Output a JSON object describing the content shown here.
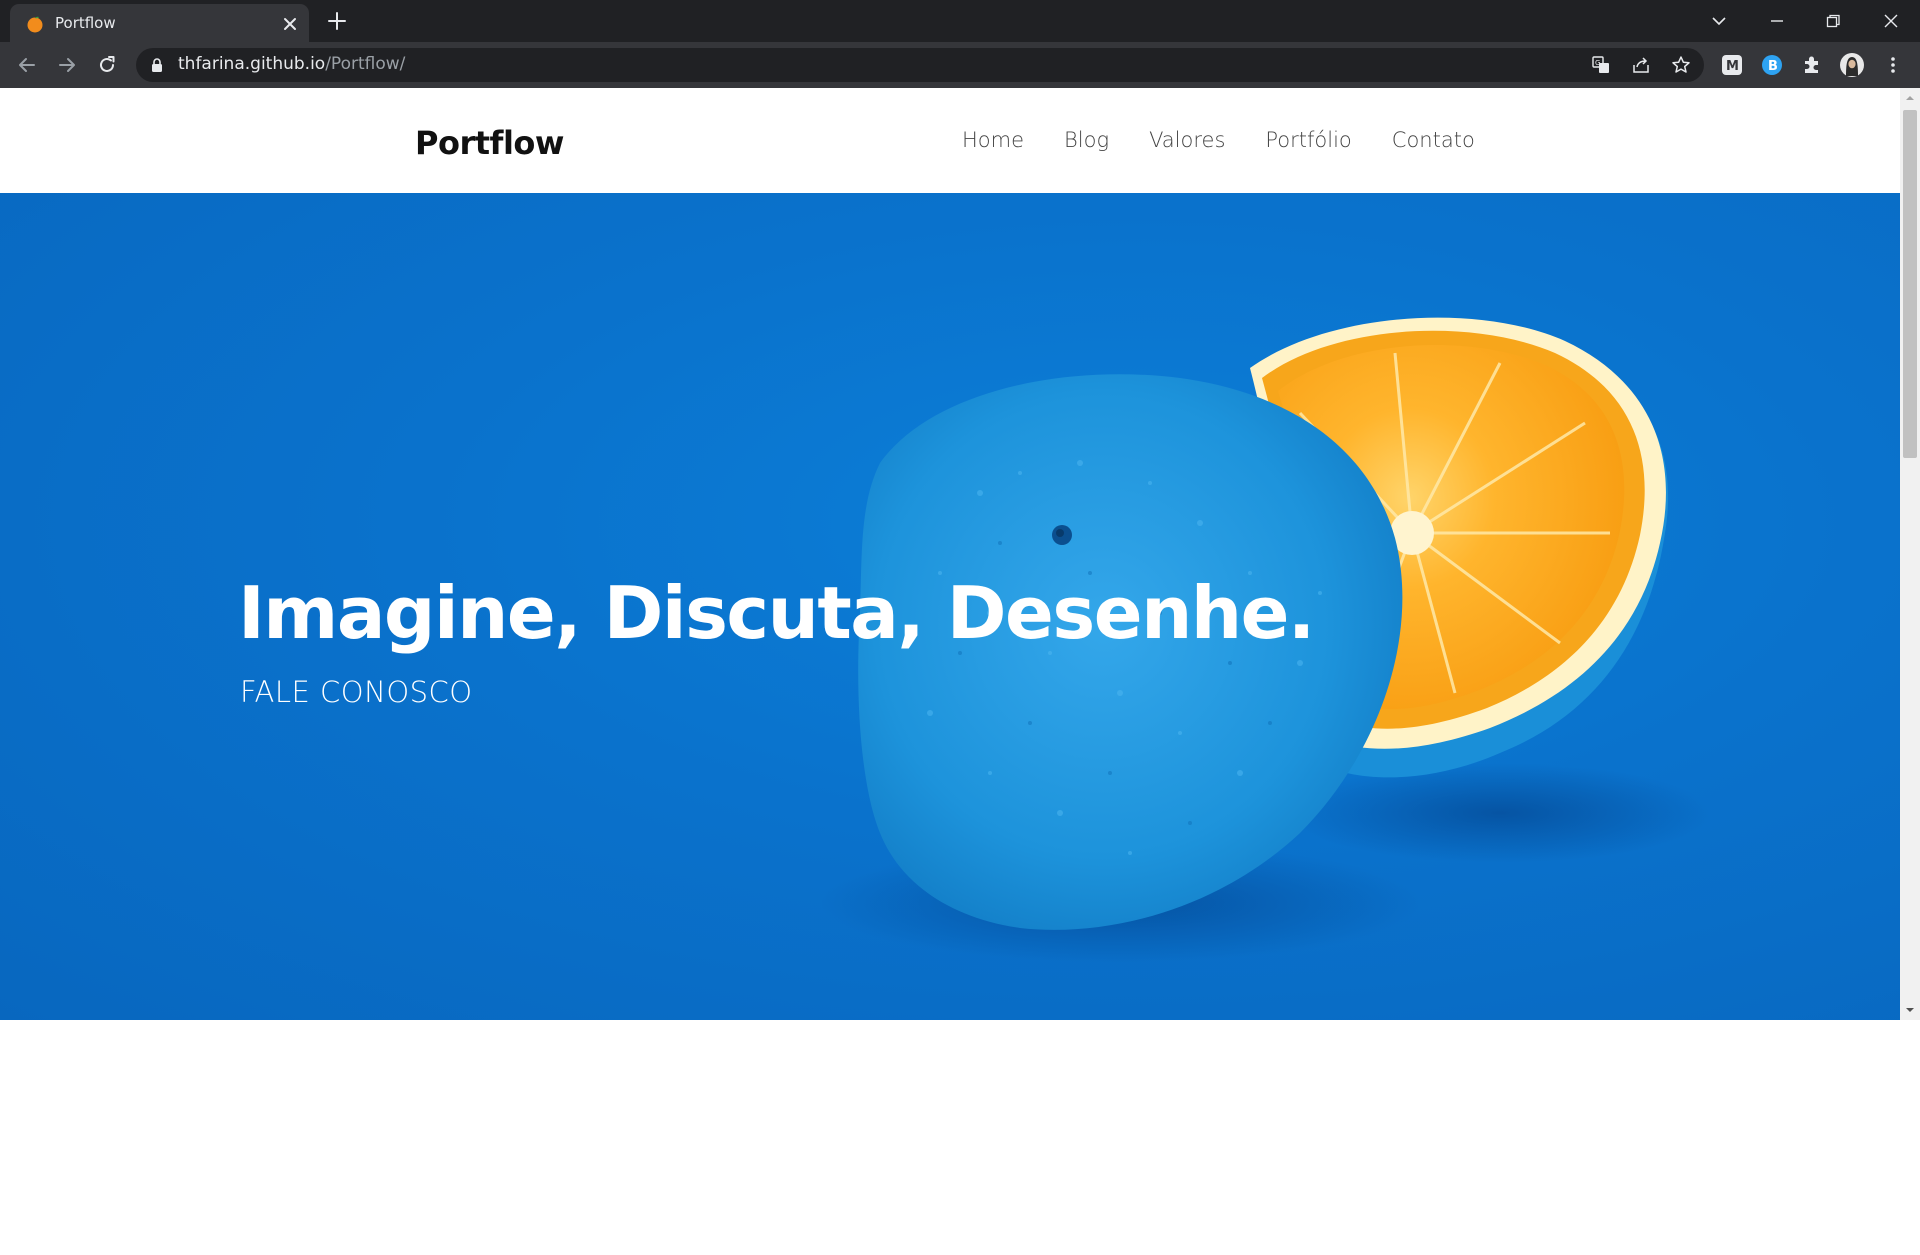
{
  "browser": {
    "tab": {
      "title": "Portflow",
      "favicon": "orange-favicon-icon"
    },
    "url_host": "thfarina.github.io",
    "url_path": "/Portflow/",
    "colors": {
      "frame": "#202124",
      "toolbar": "#35363a",
      "text": "#e8eaed",
      "muted": "#9aa0a6"
    }
  },
  "site": {
    "logo": "Portflow",
    "nav": [
      {
        "label": "Home"
      },
      {
        "label": "Blog"
      },
      {
        "label": "Valores"
      },
      {
        "label": "Portfólio"
      },
      {
        "label": "Contato"
      }
    ],
    "hero": {
      "title": "Imagine, Discuta, Desenhe.",
      "cta": "FALE CONOSCO",
      "background": "#0a72cc",
      "image": "blue-painted-orange-halves"
    }
  }
}
